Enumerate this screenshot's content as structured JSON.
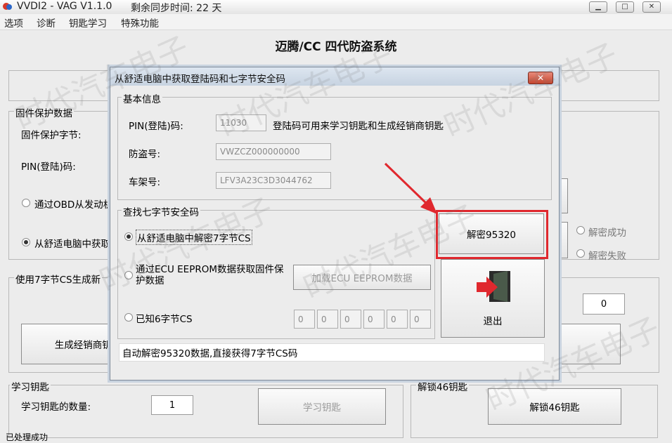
{
  "window": {
    "title": "VVDI2 - VAG V1.1.0",
    "sync_label": "剩余同步时间: 22 天"
  },
  "menu": [
    "选项",
    "诊断",
    "钥匙学习",
    "特殊功能"
  ],
  "main_title": "迈腾/CC 四代防盗系统",
  "left_panel": {
    "group_title": "固件保护数据",
    "protect_label": "固件保护字节:",
    "pin_label": "PIN(登陆)码:",
    "radio_obd": "通过OBD从发动机",
    "radio_comfort": "从舒适电脑中获取"
  },
  "gen_group": {
    "title": "使用7字节CS生成新",
    "button": "生成经销商钥匙"
  },
  "right_panel": {
    "decrypt_ok": "解密成功",
    "decrypt_fail": "解密失败",
    "count_value": "0"
  },
  "learn_group": {
    "title": "学习钥匙",
    "count_label": "学习钥匙的数量:",
    "count_value": "1",
    "learn_button": "学习钥匙"
  },
  "unlock_group": {
    "title": "解锁46钥匙",
    "button": "解锁46钥匙"
  },
  "bottom_cut_text": "已处理成功",
  "dialog": {
    "title": "从舒适电脑中获取登陆码和七字节安全码",
    "close_label": "✕",
    "basic_info": {
      "title": "基本信息",
      "pin_label": "PIN(登陆)码:",
      "pin_value": "11030",
      "pin_note": "登陆码可用来学习钥匙和生成经销商钥匙",
      "immo_label": "防盗号:",
      "immo_value": "VWZCZ000000000",
      "vin_label": "车架号:",
      "vin_value": "LFV3A23C3D3044762"
    },
    "cs_group": {
      "title": "查找七字节安全码",
      "radio_comfort": "从舒适电脑中解密7字节CS",
      "radio_eeprom": "通过ECU EEPROM数据获取固件保护数据",
      "load_eeprom_button": "加载ECU EEPROM数据",
      "radio_known": "已知6字节CS",
      "cs_bytes": [
        "0",
        "0",
        "0",
        "0",
        "0",
        "0"
      ]
    },
    "decrypt_button": "解密95320",
    "exit_button": "退出",
    "status_text": "自动解密95320数据,直接获得7字节CS码"
  },
  "watermark": "时代汽车电子",
  "colors": {
    "highlight_red": "#e0282e",
    "arrow_red": "#e0282e"
  }
}
